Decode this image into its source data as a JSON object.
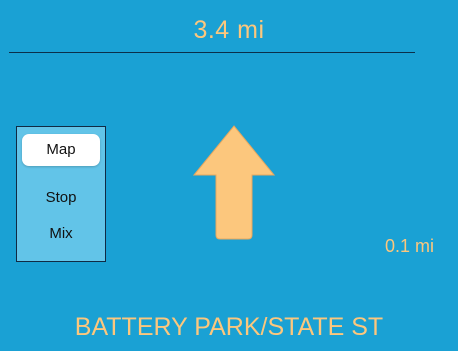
{
  "header": {
    "total_distance": "3.4 mi"
  },
  "mode_panel": {
    "items": [
      "Map",
      "Stop",
      "Mix"
    ],
    "selected": "Map"
  },
  "maneuver": {
    "icon": "straight-arrow-icon",
    "distance": "0.1 mi"
  },
  "street": {
    "name": "BATTERY PARK/STATE ST"
  },
  "colors": {
    "background": "#1aa1d4",
    "accent_text": "#fcc77d",
    "arrow_fill": "#fcc77d",
    "panel_bg": "#62c4e8",
    "selected_bg": "#ffffff"
  }
}
